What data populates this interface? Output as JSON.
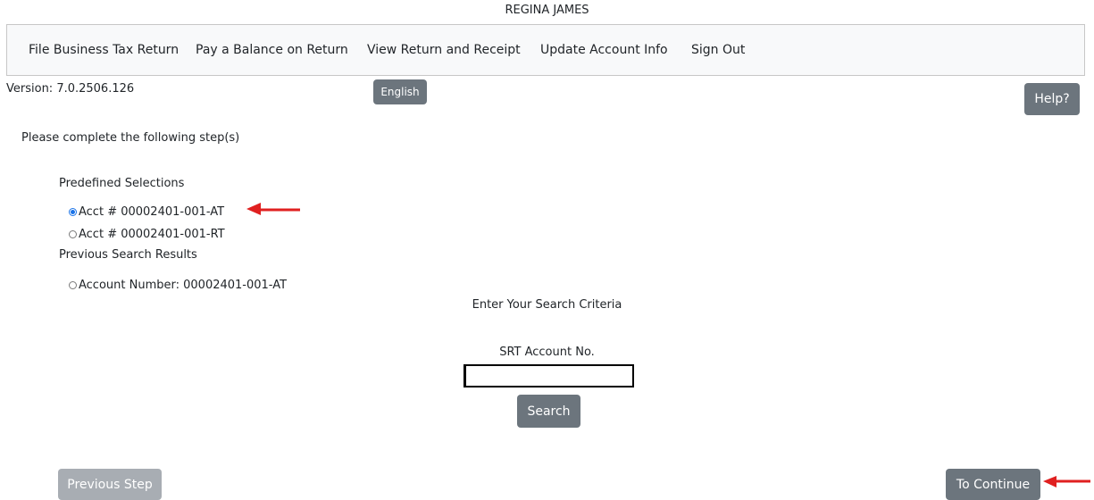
{
  "header": {
    "user_name": "REGINA JAMES"
  },
  "nav": [
    {
      "label": "File Business Tax Return"
    },
    {
      "label": "Pay a Balance on Return"
    },
    {
      "label": "View Return and Receipt"
    },
    {
      "label": "Update Account Info"
    },
    {
      "label": "Sign Out"
    }
  ],
  "version": "Version: 7.0.2506.126",
  "language_button": "English",
  "help_button": "Help?",
  "instruction": "Please complete the following step(s)",
  "predefined": {
    "title": "Predefined Selections",
    "options": [
      {
        "label": "Acct # 00002401-001-AT",
        "checked": true
      },
      {
        "label": "Acct # 00002401-001-RT",
        "checked": false
      }
    ]
  },
  "previous_results": {
    "title": "Previous Search Results",
    "options": [
      {
        "label": "Account Number: 00002401-001-AT",
        "checked": false
      }
    ]
  },
  "search": {
    "criteria_title": "Enter Your Search Criteria",
    "field_label": "SRT Account No.",
    "value": "",
    "button": "Search"
  },
  "footer": {
    "previous_button": "Previous Step",
    "continue_button": "To Continue"
  },
  "colors": {
    "arrow": "#e02020",
    "button": "#6c757d",
    "button_disabled": "#a8adb3",
    "radio_checked": "#1a73e8"
  }
}
